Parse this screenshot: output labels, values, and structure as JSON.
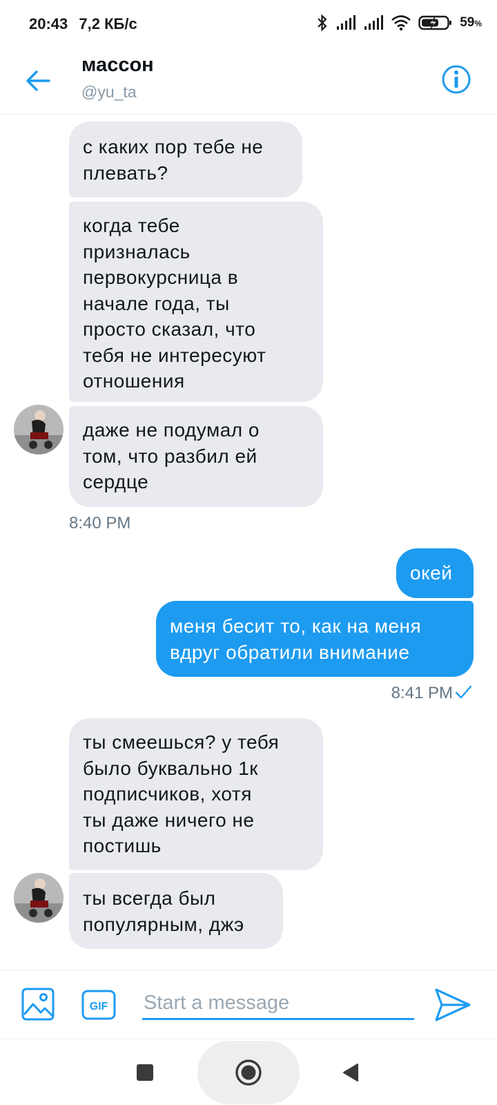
{
  "status_bar": {
    "time": "20:43",
    "speed": "7,2 КБ/с",
    "battery_percent": "59",
    "battery_unit": "%"
  },
  "header": {
    "name": "массон",
    "handle": "@yu_ta"
  },
  "messages": [
    {
      "side": "incoming",
      "text": "с каких пор тебе не плевать?"
    },
    {
      "side": "incoming",
      "text": "когда тебе призналась первокурсница в начале года, ты просто сказал, что тебя не интересуют отношения"
    },
    {
      "side": "incoming",
      "text": "даже не подумал о том, что разбил ей сердце"
    },
    {
      "side": "timestamp",
      "text": "8:40 PM"
    },
    {
      "side": "outgoing",
      "text": "окей"
    },
    {
      "side": "outgoing",
      "text": "меня бесит то, как на меня вдруг обратили внимание"
    },
    {
      "side": "timestamp",
      "text": "8:41 PM"
    },
    {
      "side": "incoming",
      "text": "ты смеешься? у тебя было буквально 1к подписчиков, хотя ты даже ничего не постишь"
    },
    {
      "side": "incoming",
      "text": "ты всегда был популярным, джэ"
    }
  ],
  "bubble_lines": {
    "m1": [
      "с каких пор тебе не",
      "плевать?"
    ],
    "m2": [
      "когда тебе",
      "призналась",
      "первокурсница в",
      "начале года, ты",
      "просто сказал, что",
      "тебя не интересуют",
      "отношения"
    ],
    "m3": [
      "даже не подумал о",
      "том, что разбил ей",
      "сердце"
    ],
    "m5": [
      "окей"
    ],
    "m6": [
      "меня бесит то, как на меня",
      "вдруг обратили внимание"
    ],
    "m8": [
      "ты смеешься? у тебя",
      "было буквально 1к",
      "подписчиков, хотя",
      "ты даже ничего не",
      "постишь"
    ],
    "m9": [
      "ты всегда был",
      "популярным, джэ"
    ]
  },
  "timestamps": {
    "t1": "8:40 PM",
    "t2": "8:41 PM"
  },
  "composer": {
    "placeholder": "Start a message",
    "gif_label": "GIF"
  },
  "colors": {
    "accent": "#1d9bf0",
    "incoming_bubble": "#e8eaef",
    "muted_text": "#657786"
  },
  "icons": {
    "back": "arrow-left-icon",
    "info": "info-circle-icon",
    "media": "image-icon",
    "gif": "gif-icon",
    "send": "send-icon",
    "read_receipt": "checkmark-icon",
    "nav_recents": "square-icon",
    "nav_home": "circle-icon",
    "nav_back": "triangle-back-icon"
  }
}
